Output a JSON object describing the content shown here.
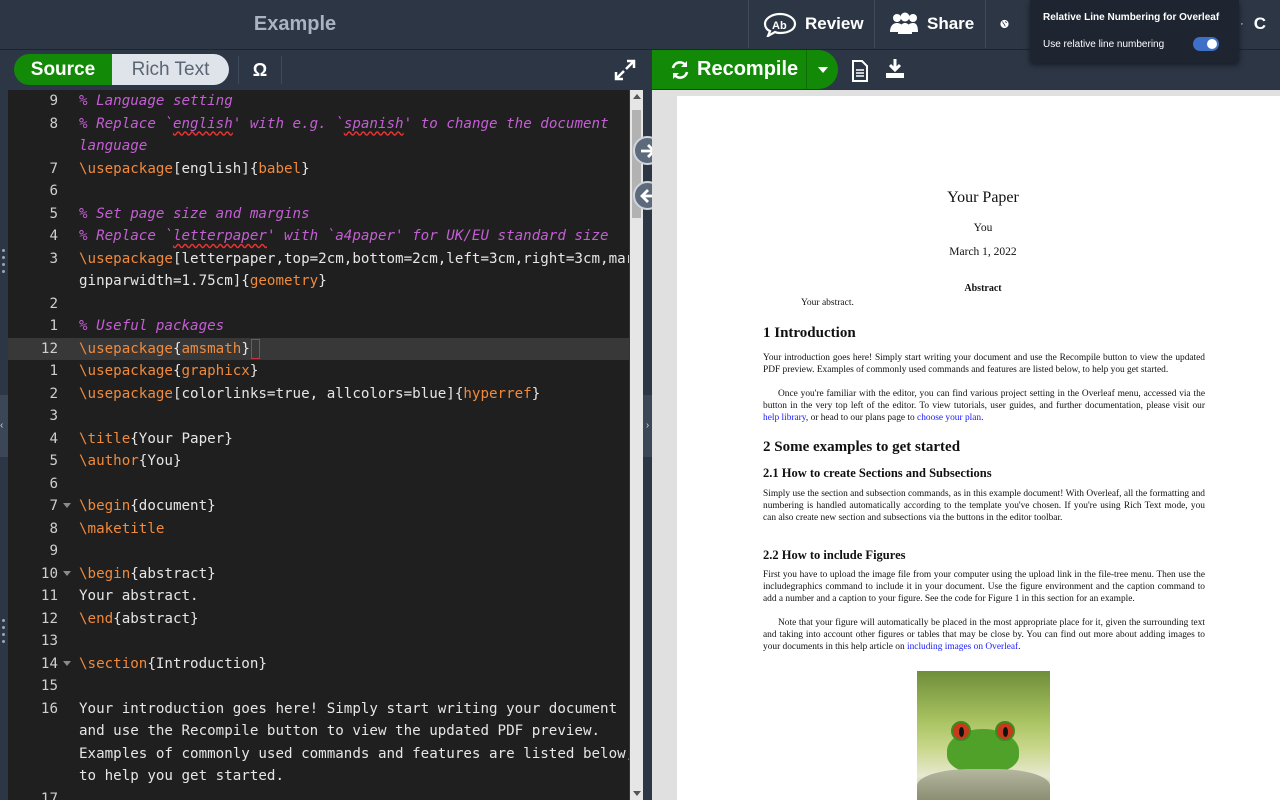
{
  "header": {
    "project_title": "Example",
    "review_label": "Review",
    "share_label": "Share",
    "chat_cut": "C"
  },
  "popup": {
    "title": "Relative Line Numbering for Overleaf",
    "toggle_label": "Use relative line numbering",
    "toggle_on": true
  },
  "editor_toolbar": {
    "source_label": "Source",
    "rich_text_label": "Rich Text",
    "symbol_label": "Ω"
  },
  "editor": {
    "lines": [
      {
        "num": "9",
        "tokens": [
          {
            "t": "cmt",
            "v": "% Language setting"
          }
        ]
      },
      {
        "num": "8",
        "tokens": [
          {
            "t": "cmt",
            "v": "% Replace `"
          },
          {
            "t": "cmt-sq",
            "v": "english"
          },
          {
            "t": "cmt",
            "v": "' with e.g. `"
          },
          {
            "t": "cmt-sq",
            "v": "spanish"
          },
          {
            "t": "cmt",
            "v": "' to change the document"
          }
        ]
      },
      {
        "num": "",
        "tokens": [
          {
            "t": "cmt",
            "v": "language"
          }
        ]
      },
      {
        "num": "7",
        "tokens": [
          {
            "t": "kw",
            "v": "\\usepackage"
          },
          {
            "t": "txt",
            "v": "[english]{"
          },
          {
            "t": "kw",
            "v": "babel"
          },
          {
            "t": "txt",
            "v": "}"
          }
        ]
      },
      {
        "num": "6",
        "tokens": []
      },
      {
        "num": "5",
        "tokens": [
          {
            "t": "cmt",
            "v": "% Set page size and margins"
          }
        ]
      },
      {
        "num": "4",
        "tokens": [
          {
            "t": "cmt",
            "v": "% Replace `"
          },
          {
            "t": "cmt-sq",
            "v": "letterpaper"
          },
          {
            "t": "cmt",
            "v": "' with `a4paper' for UK/EU standard size"
          }
        ]
      },
      {
        "num": "3",
        "tokens": [
          {
            "t": "kw",
            "v": "\\usepackage"
          },
          {
            "t": "txt",
            "v": "[letterpaper,top=2cm,bottom=2cm,left=3cm,right=3cm,mar"
          }
        ]
      },
      {
        "num": "",
        "tokens": [
          {
            "t": "txt",
            "v": "ginparwidth=1.75cm]{"
          },
          {
            "t": "kw",
            "v": "geometry"
          },
          {
            "t": "txt",
            "v": "}"
          }
        ]
      },
      {
        "num": "2",
        "tokens": []
      },
      {
        "num": "1",
        "tokens": [
          {
            "t": "cmt",
            "v": "% Useful packages"
          }
        ]
      },
      {
        "num": "12",
        "current": true,
        "tokens": [
          {
            "t": "kw",
            "v": "\\usepackage"
          },
          {
            "t": "txt",
            "v": "{"
          },
          {
            "t": "kw",
            "v": "amsmath"
          },
          {
            "t": "txt",
            "v": "}"
          },
          {
            "t": "cursor",
            "v": ""
          }
        ]
      },
      {
        "num": "1",
        "tokens": [
          {
            "t": "kw",
            "v": "\\usepackage"
          },
          {
            "t": "txt",
            "v": "{"
          },
          {
            "t": "kw",
            "v": "graphicx"
          },
          {
            "t": "txt",
            "v": "}"
          }
        ]
      },
      {
        "num": "2",
        "tokens": [
          {
            "t": "kw",
            "v": "\\usepackage"
          },
          {
            "t": "txt",
            "v": "[colorlinks=true, allcolors=blue]{"
          },
          {
            "t": "kw",
            "v": "hyperref"
          },
          {
            "t": "txt",
            "v": "}"
          }
        ]
      },
      {
        "num": "3",
        "tokens": []
      },
      {
        "num": "4",
        "tokens": [
          {
            "t": "kw",
            "v": "\\title"
          },
          {
            "t": "txt",
            "v": "{Your Paper}"
          }
        ]
      },
      {
        "num": "5",
        "tokens": [
          {
            "t": "kw",
            "v": "\\author"
          },
          {
            "t": "txt",
            "v": "{You}"
          }
        ]
      },
      {
        "num": "6",
        "tokens": []
      },
      {
        "num": "7",
        "fold": true,
        "tokens": [
          {
            "t": "kw",
            "v": "\\begin"
          },
          {
            "t": "txt",
            "v": "{document}"
          }
        ]
      },
      {
        "num": "8",
        "tokens": [
          {
            "t": "kw",
            "v": "\\maketitle"
          }
        ]
      },
      {
        "num": "9",
        "tokens": []
      },
      {
        "num": "10",
        "fold": true,
        "tokens": [
          {
            "t": "kw",
            "v": "\\begin"
          },
          {
            "t": "txt",
            "v": "{abstract}"
          }
        ]
      },
      {
        "num": "11",
        "tokens": [
          {
            "t": "txt",
            "v": "Your abstract."
          }
        ]
      },
      {
        "num": "12",
        "tokens": [
          {
            "t": "kw",
            "v": "\\end"
          },
          {
            "t": "txt",
            "v": "{abstract}"
          }
        ]
      },
      {
        "num": "13",
        "tokens": []
      },
      {
        "num": "14",
        "fold": true,
        "tokens": [
          {
            "t": "kw",
            "v": "\\section"
          },
          {
            "t": "txt",
            "v": "{Introduction}"
          }
        ]
      },
      {
        "num": "15",
        "tokens": []
      },
      {
        "num": "16",
        "tokens": [
          {
            "t": "txt",
            "v": "Your introduction goes here! Simply start writing your document"
          }
        ]
      },
      {
        "num": "",
        "tokens": [
          {
            "t": "txt",
            "v": "and use the Recompile button to view the updated PDF preview."
          }
        ]
      },
      {
        "num": "",
        "tokens": [
          {
            "t": "txt",
            "v": "Examples of commonly used commands and features are listed below,"
          }
        ]
      },
      {
        "num": "",
        "tokens": [
          {
            "t": "txt",
            "v": "to help you get started."
          }
        ]
      },
      {
        "num": "17",
        "tokens": []
      }
    ]
  },
  "pdf_toolbar": {
    "recompile_label": "Recompile"
  },
  "pdf": {
    "title": "Your Paper",
    "author": "You",
    "date": "March 1, 2022",
    "abstract_heading": "Abstract",
    "abstract_text": "Your abstract.",
    "sec1": "1    Introduction",
    "sec1_p1": "Your introduction goes here! Simply start writing your document and use the Recompile button to view the updated PDF preview. Examples of commonly used commands and features are listed below, to help you get started.",
    "sec1_p2_a": "Once you're familiar with the editor, you can find various project setting in the Overleaf menu, accessed via the button in the very top left of the editor. To view tutorials, user guides, and further documentation, please visit our ",
    "sec1_p2_link1": "help library",
    "sec1_p2_b": ", or head to our plans page to ",
    "sec1_p2_link2": "choose your plan",
    "sec1_p2_c": ".",
    "sec2": "2    Some examples to get started",
    "sub21": "2.1    How to create Sections and Subsections",
    "sub21_p": "Simply use the section and subsection commands, as in this example document! With Overleaf, all the formatting and numbering is handled automatically according to the template you've chosen. If you're using Rich Text mode, you can also create new section and subsections via the buttons in the editor toolbar.",
    "sub22": "2.2    How to include Figures",
    "sub22_p1": "First you have to upload the image file from your computer using the upload link in the file-tree menu. Then use the includegraphics command to include it in your document. Use the figure environment and the caption command to add a number and a caption to your figure. See the code for Figure 1 in this section for an example.",
    "sub22_p2_a": "Note that your figure will automatically be placed in the most appropriate place for it, given the surrounding text and taking into account other figures or tables that may be close by. You can find out more about adding images to your documents in this help article on ",
    "sub22_p2_link": "including images on Overleaf",
    "sub22_p2_b": "."
  },
  "colors": {
    "green": "#138a07",
    "header_bg": "#2c3645",
    "editor_bg": "#1f1f1f",
    "comment": "#c45ed4",
    "keyword": "#f08a3c",
    "link": "#1a1aff"
  }
}
